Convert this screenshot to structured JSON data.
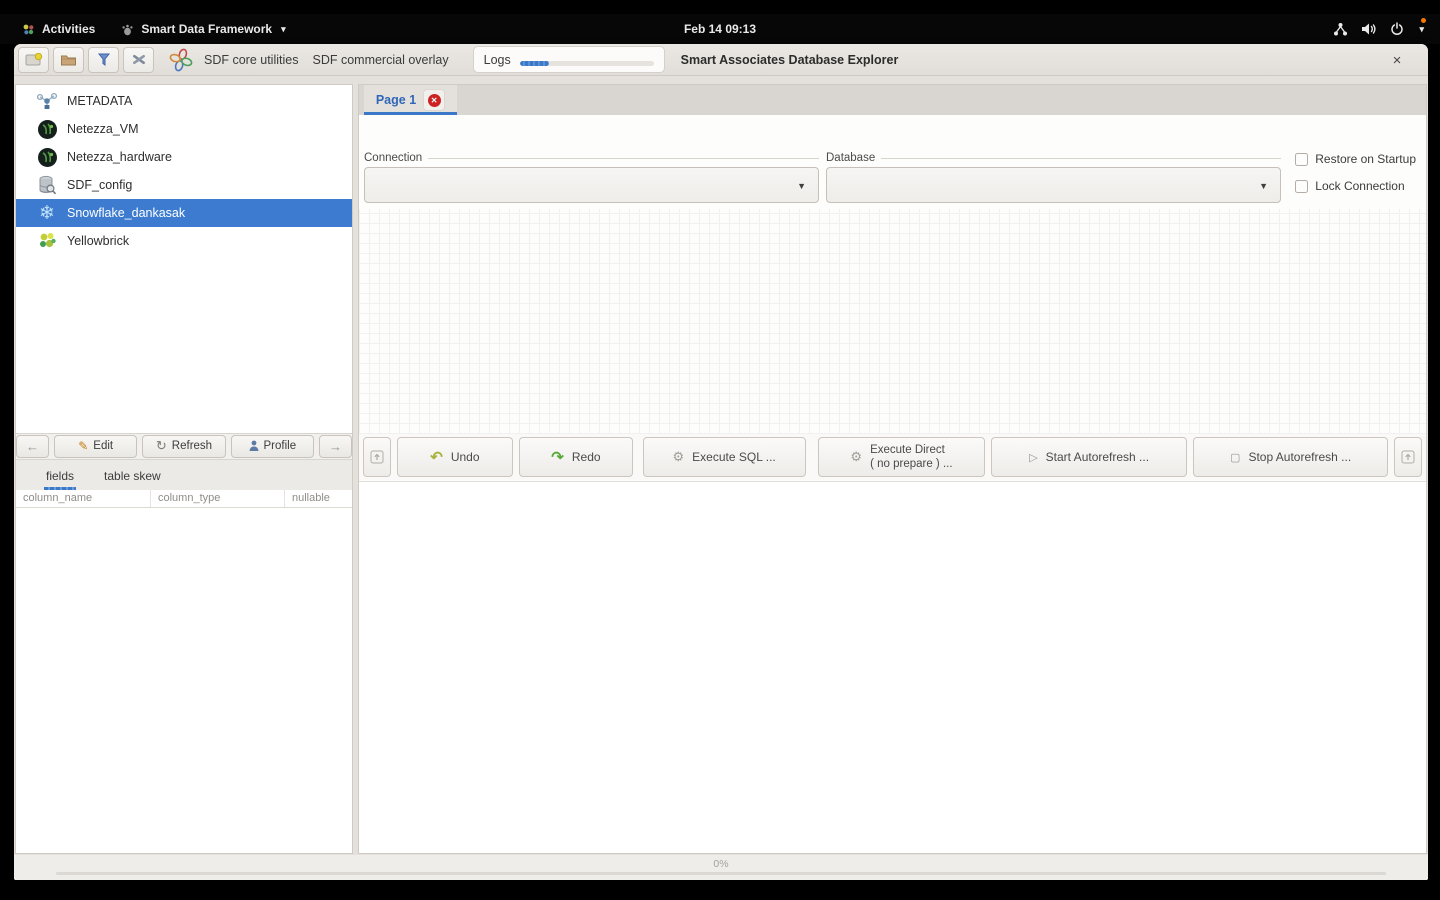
{
  "topbar": {
    "activities_label": "Activities",
    "app_menu_label": "Smart Data Framework",
    "clock": "Feb 14 09:13"
  },
  "toolbar": {
    "menu_core": "SDF core utilities",
    "menu_overlay": "SDF commercial overlay",
    "logs_label": "Logs",
    "logs_progress_percent": 22,
    "window_title": "Smart Associates Database Explorer",
    "close_glyph": "×"
  },
  "sidebar": {
    "connections": [
      {
        "label": "METADATA",
        "icon": "metadata-graph-icon"
      },
      {
        "label": "Netezza_VM",
        "icon": "netezza-appliance-icon"
      },
      {
        "label": "Netezza_hardware",
        "icon": "netezza-appliance-icon"
      },
      {
        "label": "SDF_config",
        "icon": "database-search-icon"
      },
      {
        "label": "Snowflake_dankasak",
        "icon": "snowflake-icon",
        "selected": true
      },
      {
        "label": "Yellowbrick",
        "icon": "yellowbrick-cluster-icon"
      }
    ],
    "actions": {
      "back_glyph": "←",
      "edit_label": "Edit",
      "refresh_label": "Refresh",
      "profile_label": "Profile",
      "forward_glyph": "→"
    },
    "tabs": [
      {
        "label": "fields",
        "selected": true
      },
      {
        "label": "table skew",
        "selected": false
      }
    ],
    "table_headers": [
      "column_name",
      "column_type",
      "nullable"
    ]
  },
  "main": {
    "page_tab_label": "Page 1",
    "tab_close_glyph": "✕",
    "connection_legend": "Connection",
    "database_legend": "Database",
    "combo_arrow_glyph": "▼",
    "checkbox_restore": "Restore on Startup",
    "checkbox_lock": "Lock Connection",
    "exec_buttons": {
      "undo": "Undo",
      "redo": "Redo",
      "execute_sql": "Execute SQL ...",
      "execute_direct_line1": "Execute Direct",
      "execute_direct_line2": "( no prepare ) ...",
      "start_autorefresh": "Start Autorefresh ...",
      "stop_autorefresh": "Stop Autorefresh ..."
    }
  },
  "statusbar": {
    "progress_text": "0%"
  },
  "icons": {
    "undo_glyph": "↶",
    "redo_glyph": "↷",
    "engine_glyph": "⚙",
    "play_glyph": "▷",
    "stop_glyph": "▢",
    "pencil_glyph": "✎",
    "refresh_glyph": "↻",
    "snowflake_glyph": "❄",
    "caret_glyph": "▾"
  },
  "colors": {
    "selection_blue": "#3c7bd0",
    "tab_accent_blue": "#3c78c8",
    "close_red": "#cc2222",
    "notification_orange": "#f57900"
  }
}
